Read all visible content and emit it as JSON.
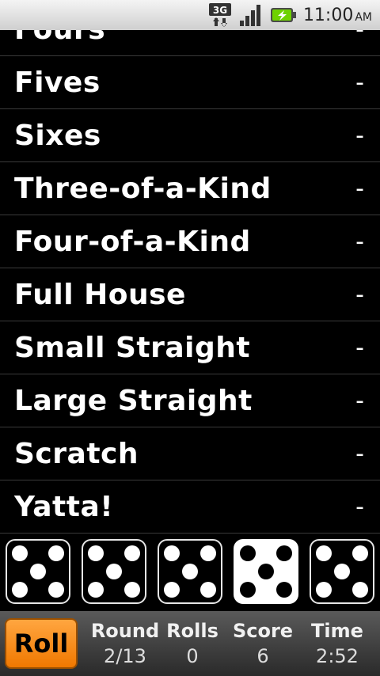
{
  "status_bar": {
    "network": "3G",
    "time": "11:00",
    "ampm": "AM"
  },
  "score_rows": [
    {
      "label": "Fours",
      "value": "-"
    },
    {
      "label": "Fives",
      "value": "-"
    },
    {
      "label": "Sixes",
      "value": "-"
    },
    {
      "label": "Three-of-a-Kind",
      "value": "-"
    },
    {
      "label": "Four-of-a-Kind",
      "value": "-"
    },
    {
      "label": "Full House",
      "value": "-"
    },
    {
      "label": "Small Straight",
      "value": "-"
    },
    {
      "label": "Large Straight",
      "value": "-"
    },
    {
      "label": "Scratch",
      "value": "-"
    },
    {
      "label": "Yatta!",
      "value": "-"
    }
  ],
  "dice": [
    {
      "value": 5,
      "held": false
    },
    {
      "value": 5,
      "held": false
    },
    {
      "value": 5,
      "held": false
    },
    {
      "value": 5,
      "held": true
    },
    {
      "value": 5,
      "held": false
    }
  ],
  "bottom_bar": {
    "roll_label": "Roll",
    "round_label": "Round",
    "round_value": "2/13",
    "rolls_label": "Rolls",
    "rolls_value": "0",
    "score_label": "Score",
    "score_value": "6",
    "time_label": "Time",
    "time_value": "2:52"
  }
}
